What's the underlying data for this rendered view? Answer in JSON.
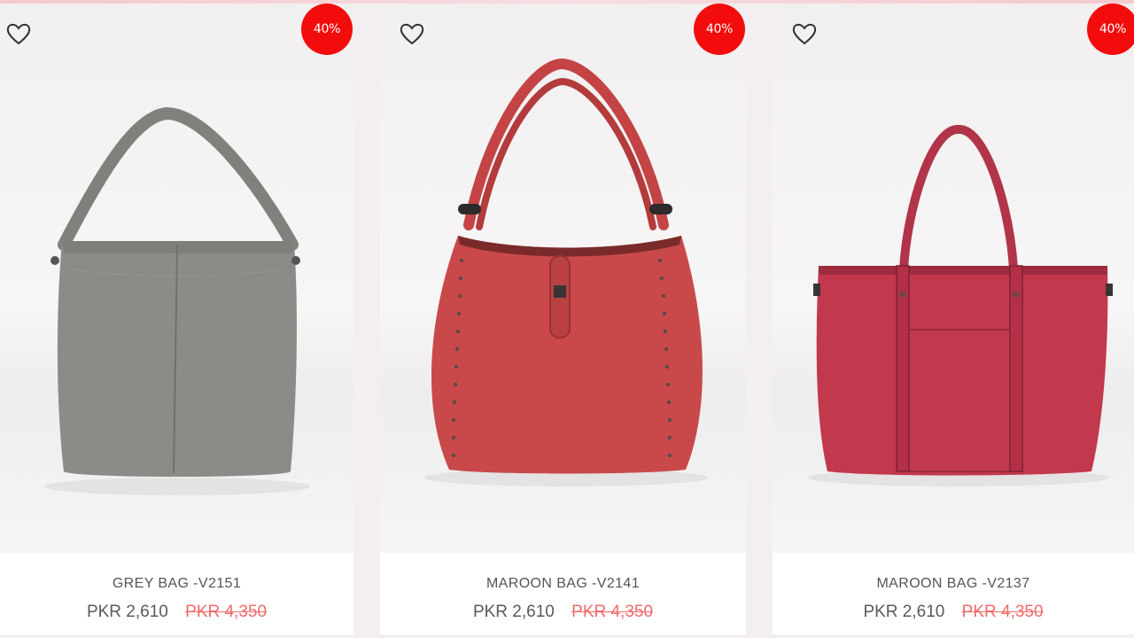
{
  "products": [
    {
      "name": "GREY BAG -V2151",
      "price": "PKR 2,610",
      "old_price": "PKR 4,350",
      "discount_badge": "40%",
      "bag_color": "#8a8d87",
      "wishlist_icon": "heart-outline-icon"
    },
    {
      "name": "MAROON BAG -V2141",
      "price": "PKR 2,610",
      "old_price": "PKR 4,350",
      "discount_badge": "40%",
      "bag_color": "#c9494a",
      "wishlist_icon": "heart-outline-icon"
    },
    {
      "name": "MAROON BAG -V2137",
      "price": "PKR 2,610",
      "old_price": "PKR 4,350",
      "discount_badge": "40%",
      "bag_color": "#c2384d",
      "wishlist_icon": "heart-outline-icon"
    }
  ],
  "colors": {
    "badge": "#f20c0c",
    "old_price": "#f06a6a",
    "price": "#5a5a5a"
  }
}
